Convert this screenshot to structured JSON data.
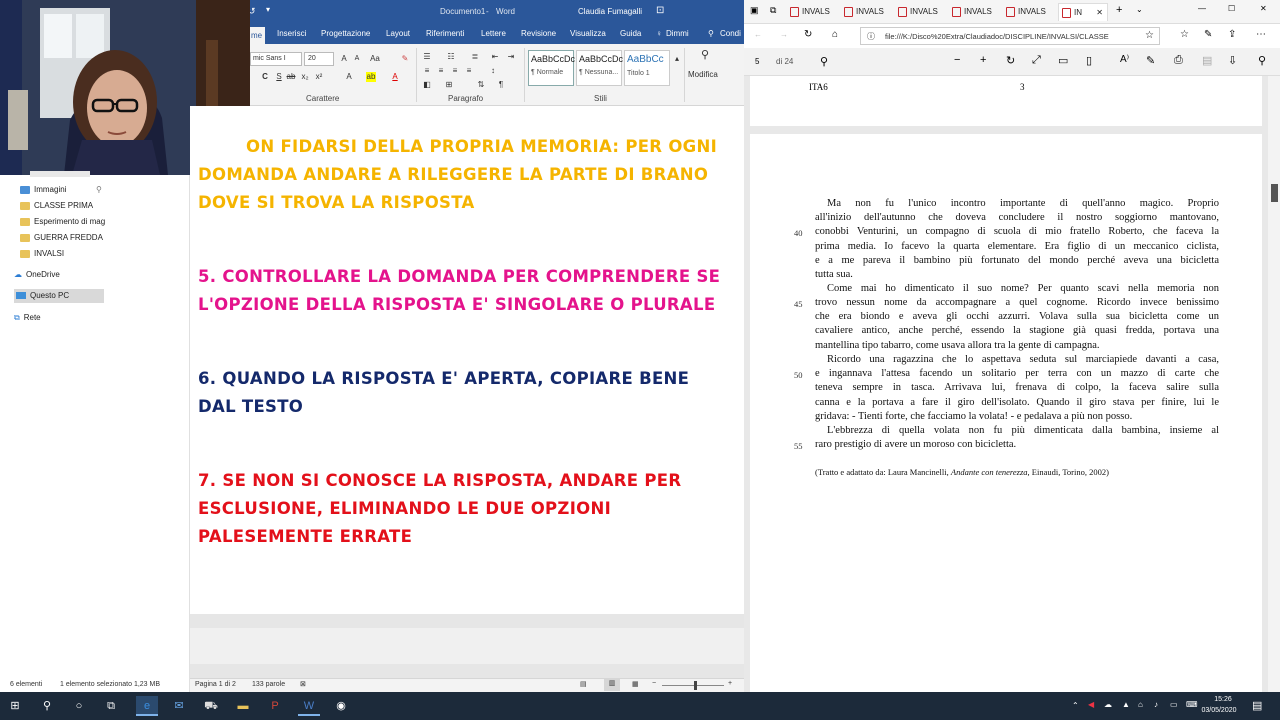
{
  "word": {
    "title_doc": "Documento1",
    "title_app": "Word",
    "user": "Claudia Fumagalli",
    "tabs": [
      "me",
      "Inserisci",
      "Progettazione",
      "Layout",
      "Riferimenti",
      "Lettere",
      "Revisione",
      "Visualizza",
      "Guida",
      "Dimmi",
      "Condi"
    ],
    "font_name": "mic Sans I",
    "font_size": "20",
    "groups": {
      "carattere": "Carattere",
      "paragrafo": "Paragrafo",
      "stili": "Stili",
      "modifica": "Modifica"
    },
    "styles": [
      {
        "sample": "AaBbCcDc",
        "name": "¶ Normale"
      },
      {
        "sample": "AaBbCcDc",
        "name": "¶ Nessuna..."
      },
      {
        "sample": "AaBbCc",
        "name": "Titolo 1"
      }
    ],
    "doc": {
      "p4_lines": [
        "ON FIDARSI DELLA PROPRIA MEMORIA: PER OGNI",
        "DOMANDA ANDARE A RILEGGERE LA PARTE DI BRANO",
        "DOVE SI TROVA LA RISPOSTA"
      ],
      "p5_lines": [
        "5. CONTROLLARE LA DOMANDA PER COMPRENDERE SE",
        "L'OPZIONE DELLA RISPOSTA E' SINGOLARE O PLURALE"
      ],
      "p6_lines": [
        "6. QUANDO LA RISPOSTA E' APERTA, COPIARE BENE",
        "DAL TESTO"
      ],
      "p7_lines": [
        "7. SE NON SI CONOSCE LA RISPOSTA, ANDARE PER",
        "ESCLUSIONE, ELIMINANDO LE DUE OPZIONI",
        "PALESEMENTE ERRATE"
      ]
    },
    "colors": {
      "p4": "#f5b400",
      "p5": "#e4138c",
      "p6": "#14296b",
      "p7": "#e3101a",
      "ribbon": "#2b579a"
    },
    "status": {
      "page": "Pagina 1 di 2",
      "words": "133 parole"
    }
  },
  "explorer": {
    "items": [
      {
        "label": "Immagini",
        "icon": "folder-icon"
      },
      {
        "label": "CLASSE PRIMA",
        "icon": "folder-icon"
      },
      {
        "label": "Esperimento di mag",
        "icon": "folder-icon"
      },
      {
        "label": "GUERRA FREDDA",
        "icon": "folder-icon"
      },
      {
        "label": "INVALSI",
        "icon": "folder-icon"
      }
    ],
    "onedrive": "OneDrive",
    "thispc": "Questo PC",
    "network": "Rete",
    "status_count": "6 elementi",
    "status_sel": "1 elemento selezionato  1,23 MB"
  },
  "edge": {
    "tabs": [
      "INVALS",
      "INVALS",
      "INVALS",
      "INVALS",
      "INVALS",
      "IN"
    ],
    "url": "file:///K:/Disco%20Extra/Claudiadoc/DISCIPLINE/INVALSI/CLASSE",
    "page_current": "5",
    "page_total": "di 24"
  },
  "pdf": {
    "header_left": "ITA6",
    "header_right": "3",
    "lines": [
      "Ma non fu l'unico incontro importante di quell'anno magico. Proprio",
      "all'inizio dell'autunno che doveva concludere il nostro soggiorno mantovano,",
      "conobbi Venturini, un compagno di scuola di mio fratello Roberto, che faceva la",
      "prima media. Io facevo la quarta elementare. Era figlio di un meccanico ciclista,",
      "e a me pareva il bambino più fortunato del mondo perché aveva una bicicletta",
      "tutta sua.",
      "Come mai ho dimenticato il suo nome? Per quanto scavi nella memoria non",
      "trovo nessun nome da accompagnare a quel cognome. Ricordo invece benissimo",
      "che era biondo e aveva gli occhi azzurri. Volava sulla sua bicicletta come un",
      "cavaliere antico, anche perché, essendo la stagione già quasi fredda, portava una",
      "mantellina tipo tabarro, come usava allora tra la gente di campagna.",
      "Ricordo una ragazzina che lo aspettava seduta sul marciapiede davanti a casa,",
      "e ingannava l'attesa facendo un solitario per terra con un mazzo di carte che",
      "teneva sempre in tasca. Arrivava lui, frenava di colpo, la faceva salire sulla",
      "canna e la portava a fare il giro dell'isolato. Quando il giro stava per finire, lui le",
      "gridava: - Tienti forte, che facciamo la volata! - e pedalava a più non posso.",
      "L'ebbrezza di quella volata non fu più dimenticata dalla bambina, insieme al",
      "raro prestigio di avere un moroso con bicicletta."
    ],
    "line_numbers": {
      "l40": "40",
      "l45": "45",
      "l50": "50",
      "l55": "55"
    },
    "source_prefix": "(Tratto e adattato da: Laura Mancinelli, ",
    "source_title": "Andante con tenerezza",
    "source_suffix": ", Einaudi, Torino, 2002)"
  },
  "taskbar": {
    "time": "15:26",
    "date": "03/05/2020"
  }
}
